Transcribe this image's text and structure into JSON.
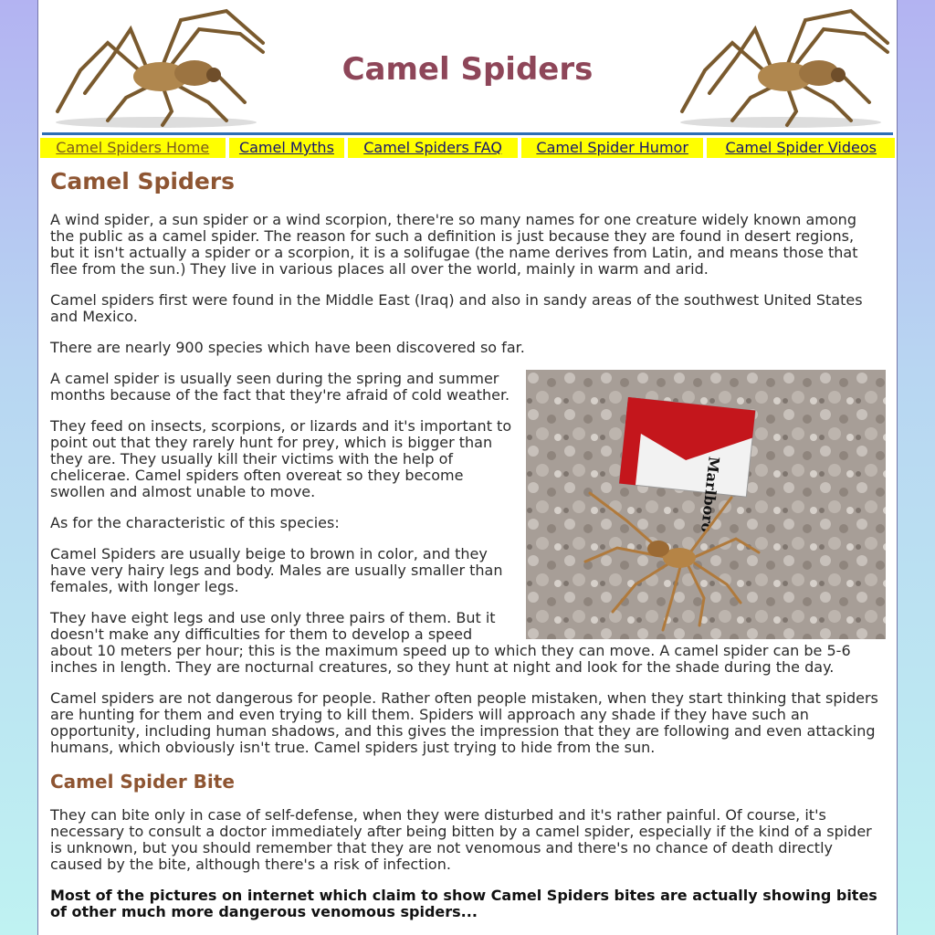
{
  "header": {
    "title": "Camel Spiders",
    "left_image_alt": "camel spider illustration",
    "right_image_alt": "camel spider illustration"
  },
  "nav": [
    {
      "label": "Camel Spiders Home"
    },
    {
      "label": "Camel Myths"
    },
    {
      "label": "Camel Spiders FAQ"
    },
    {
      "label": "Camel Spider Humor"
    },
    {
      "label": "Camel Spider Videos"
    }
  ],
  "article": {
    "heading": "Camel Spiders",
    "p1": "A wind spider, a sun spider or a wind scorpion, there're so many names for one creature widely known among the public as a camel spider. The reason for such a definition is just because they are found in desert regions, but it isn't actually a spider or a scorpion, it is a solifugae (the name derives from Latin, and means those that flee from the sun.) They live in various places all over the world, mainly in warm and arid.",
    "p2": "Camel spiders first were found in the Middle East (Iraq) and also in sandy areas of the southwest United States and Mexico.",
    "p3": "There are nearly 900 species which have been discovered so far.",
    "p4": "A camel spider is usually seen during the spring and summer months because of the fact that they're afraid of cold weather.",
    "p5": "They feed on insects, scorpions, or lizards and it's important to point out that they rarely hunt for prey, which is bigger than they are. They usually kill their victims with the help of chelicerae. Camel spiders often overeat so they become swollen and almost unable to move.",
    "p6": "As for the characteristic of this species:",
    "p7": "Camel Spiders are usually beige to brown in color, and they have very hairy legs and body. Males are usually smaller than females, with longer legs.",
    "p8": "They have eight legs and use only three pairs of them. But it doesn't make any difficulties for them to develop a speed about 10 meters per hour; this is the maximum speed up to which they can move. A camel spider can be 5-6 inches in length. They are nocturnal creatures, so they hunt at night and look for the shade during the day.",
    "p9": "Camel spiders are not dangerous for people. Rather often people mistaken, when they start thinking that spiders are hunting for them and even trying to kill them. Spiders will approach any shade if they have such an opportunity, including human shadows, and this gives the impression that they are following and even attacking humans, which obviously isn't true. Camel spiders just trying to hide from the sun.",
    "photo_pack_text": "Marlboro",
    "bite_heading": "Camel Spider Bite",
    "p10": "They can bite only in case of self-defense, when they were disturbed and it's rather painful. Of course, it's necessary to consult a doctor immediately after being bitten by a camel spider, especially if the kind of a spider is unknown, but you should remember that they are not venomous and there's no chance of death directly caused by the bite, although there's a risk of infection.",
    "p11": "Most of the pictures on internet which claim to show Camel Spiders bites are actually showing bites of other much more dangerous venomous spiders..."
  },
  "colors": {
    "title": "#8e4659",
    "heading": "#8e5532",
    "nav_bg": "#ffff00",
    "nav_text": "#16166e",
    "rule": "#2c6fb4"
  }
}
